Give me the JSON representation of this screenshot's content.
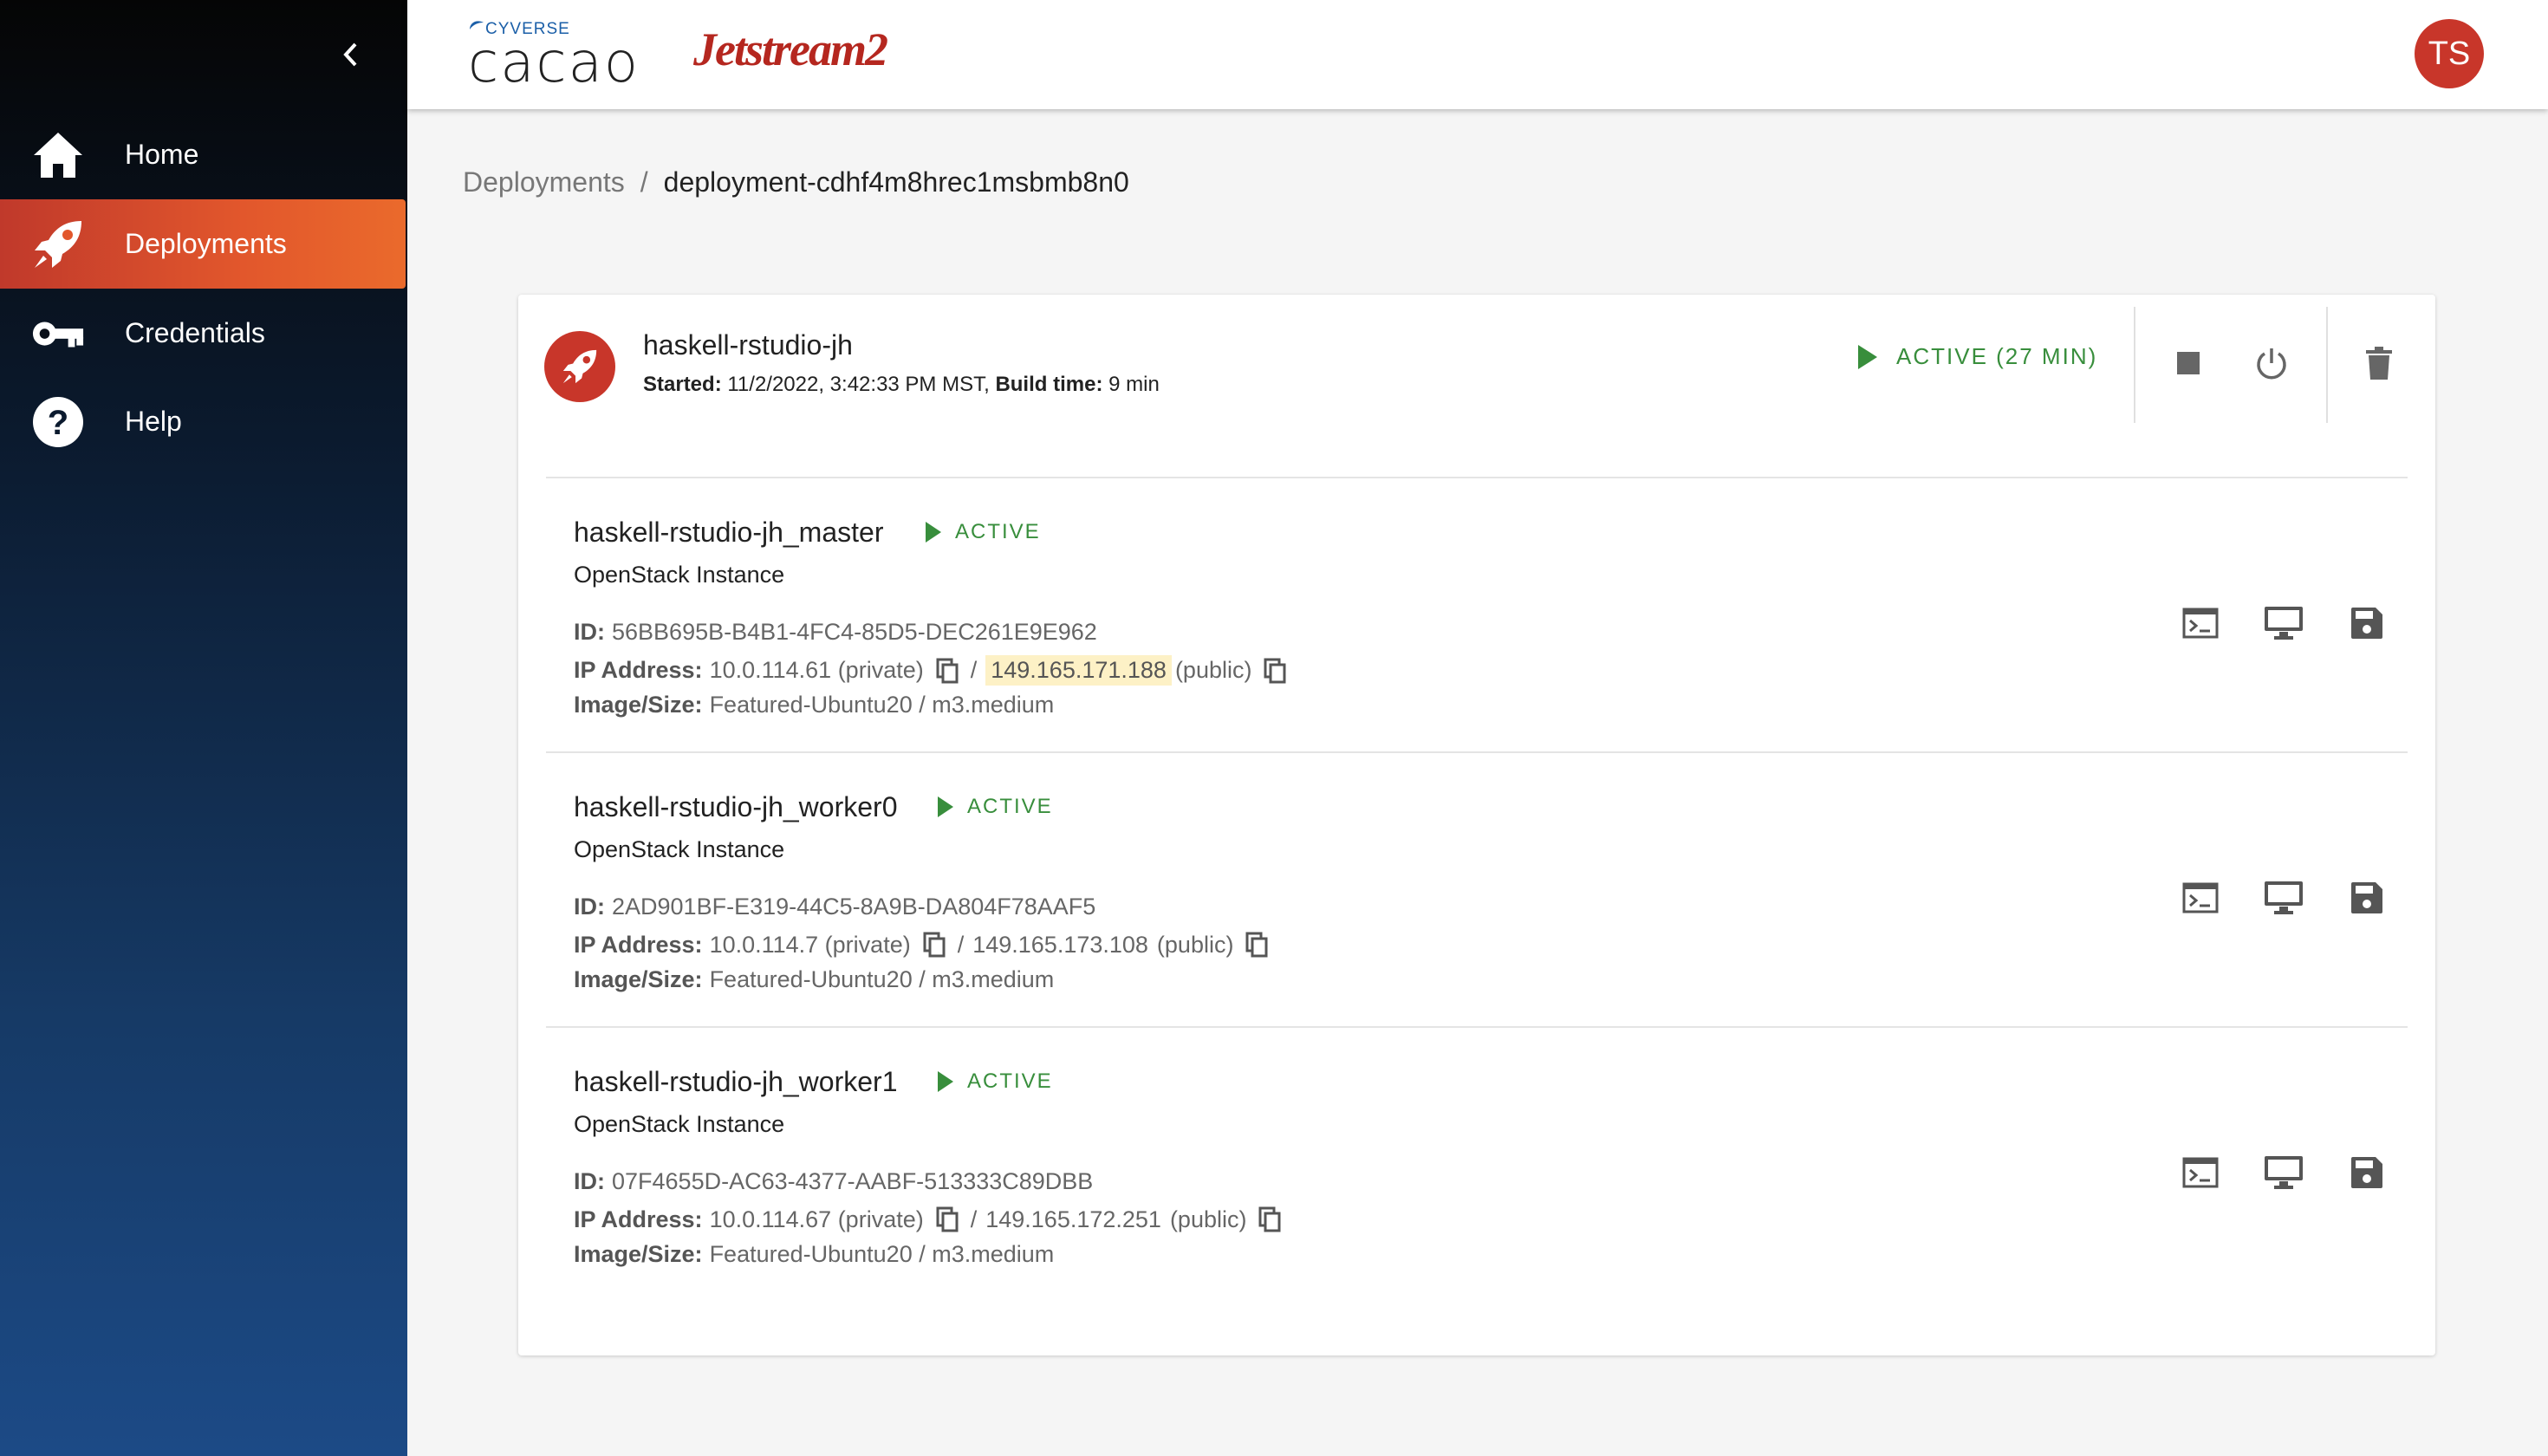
{
  "nav": {
    "items": [
      {
        "label": "Home",
        "icon": "home-icon"
      },
      {
        "label": "Deployments",
        "icon": "rocket-icon"
      },
      {
        "label": "Credentials",
        "icon": "key-icon"
      },
      {
        "label": "Help",
        "icon": "help-icon"
      }
    ],
    "active": "Deployments"
  },
  "header": {
    "logo_small": "CYVERSE",
    "logo_main": "cacao",
    "logo_secondary": "Jetstream2",
    "user_initials": "TS"
  },
  "breadcrumb": {
    "parent": "Deployments",
    "separator": "/",
    "current": "deployment-cdhf4m8hrec1msbmb8n0"
  },
  "deployment": {
    "name": "haskell-rstudio-jh",
    "started_label": "Started:",
    "started_value": "11/2/2022, 3:42:33 PM MST,",
    "build_label": "Build time:",
    "build_value": "9 min",
    "status": "ACTIVE (27 MIN)"
  },
  "labels": {
    "id": "ID:",
    "ip": "IP Address:",
    "image": "Image/Size:",
    "slash": "/"
  },
  "instances": [
    {
      "name": "haskell-rstudio-jh_master",
      "status": "ACTIVE",
      "type": "OpenStack Instance",
      "id": "56BB695B-B4B1-4FC4-85D5-DEC261E9E962",
      "private_ip": "10.0.114.61 (private)",
      "public_ip": "149.165.171.188",
      "public_suffix": "(public)",
      "image_size": "Featured-Ubuntu20 / m3.medium"
    },
    {
      "name": "haskell-rstudio-jh_worker0",
      "status": "ACTIVE",
      "type": "OpenStack Instance",
      "id": "2AD901BF-E319-44C5-8A9B-DA804F78AAF5",
      "private_ip": "10.0.114.7 (private)",
      "public_ip": "149.165.173.108",
      "public_suffix": "(public)",
      "image_size": "Featured-Ubuntu20 / m3.medium"
    },
    {
      "name": "haskell-rstudio-jh_worker1",
      "status": "ACTIVE",
      "type": "OpenStack Instance",
      "id": "07F4655D-AC63-4377-AABF-513333C89DBB",
      "private_ip": "10.0.114.67 (private)",
      "public_ip": "149.165.172.251",
      "public_suffix": "(public)",
      "image_size": "Featured-Ubuntu20 / m3.medium"
    }
  ],
  "colors": {
    "accent": "#e2572c",
    "status_active": "#388e3c",
    "avatar": "#c8362a",
    "highlight": "#fdf1c6"
  }
}
